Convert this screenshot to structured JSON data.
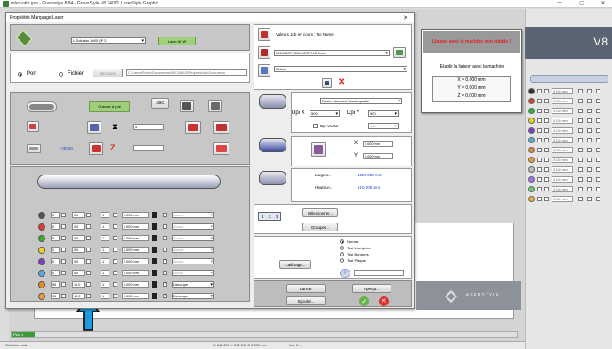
{
  "app": {
    "title": "robot-otto.gsh - Gravostyle 8.84 - GravoStyle V8 24001 LaserStyle Graphic",
    "window_controls": [
      "—",
      "▢",
      "✕"
    ],
    "v8_text": "V8",
    "status_left": "Sélection vide",
    "status_coords": "X 845.872  Y 810.392  Z 0.000 mm",
    "status_view": "Vue 2...",
    "doc_tab": "Plan 1"
  },
  "dialog": {
    "title": "Propriétés Marquage Laser",
    "machine_combo": "L-Solution 1000 (IP 2",
    "laser_btn": "Laser 80 W",
    "port_label": "Port",
    "file_label": "Fichier",
    "browse_btn": "Parcourir",
    "file_path": "C:\\Users\\Public\\Documents\\MECANIUS\\ProjetsWork\\Gravure.ini",
    "values_label": "Valeurs Job en cours : No Name",
    "material_combo": "L510000P-80W-ACRYLIC 5mm",
    "default_combo": "Défaut",
    "engrave_btn": "Gravure à plat",
    "abc_btn": "ABC",
    "x_value": "5",
    "offset_label": "+30,30",
    "raster_combo": "Raster standard Haute qualité",
    "dpi_x_label": "Dpi X",
    "dpi_x_value": "500",
    "dpi_y_label": "Dpi Y",
    "dpi_y_value": "500",
    "dpi_vector_label": "Dpi Vector",
    "dpi_vector_value": "500",
    "coord_x_label": "X",
    "coord_x_value": "0.000 mm",
    "coord_y_label": "Y",
    "coord_y_value": "0.000 mm",
    "width_label": "Largeur=",
    "width_value": "1220.000 mm",
    "height_label": "Hauteur=",
    "height_value": "610.000 mm",
    "pages": [
      "1",
      "2",
      "3"
    ],
    "select_btn": "Sélectionner...",
    "group_btn": "Grouper...",
    "calibrate_btn": "Calibrage...",
    "mode_options": [
      "Normal",
      "Test Inscription",
      "Test Bordures",
      "Test Plaque"
    ],
    "run_btn": "Lancer",
    "preview_btn": "Aperçu...",
    "spool_btn": "Spooler...",
    "logo_text": "LASERSTYLE",
    "pass_rows": [
      {
        "color": "#555555",
        "a": "0",
        "b": "0.0",
        "c": "1",
        "d": "0.000 mm",
        "mode": "Aucun",
        "checked": false
      },
      {
        "color": "#e23b2e",
        "a": "0",
        "b": "0.0",
        "c": "1",
        "d": "0.000 mm",
        "mode": "Aucun",
        "checked": false
      },
      {
        "color": "#2fb52f",
        "a": "0",
        "b": "0.0",
        "c": "1",
        "d": "0.000 mm",
        "mode": "Aucun",
        "checked": false
      },
      {
        "color": "#f1d21d",
        "a": "0",
        "b": "0.0",
        "c": "1",
        "d": "0.000 mm",
        "mode": "Aucun",
        "checked": false
      },
      {
        "color": "#7b3fc9",
        "a": "0",
        "b": "0.0",
        "c": "1",
        "d": "0.000 mm",
        "mode": "Aucun",
        "checked": true
      },
      {
        "color": "#4fb0e0",
        "a": "0",
        "b": "0.0",
        "c": "1",
        "d": "0.000 mm",
        "mode": "Aucun",
        "checked": false
      },
      {
        "color": "#e88a2a",
        "a": "95",
        "b": "10.0",
        "c": "1",
        "d": "0.000 mm",
        "mode": "Découpe",
        "checked": true
      },
      {
        "color": "#f0a032",
        "a": "95",
        "b": "10.0",
        "c": "1",
        "d": "0.000 mm",
        "mode": "Découpe",
        "checked": true
      }
    ]
  },
  "popup": {
    "header": "Liaison avec la machine non établie !",
    "action": "Etablir la liaison avec la machine",
    "x": "X = 0.000 mm",
    "y": "Y = 0.000 mm",
    "z": "Z = 0.000 mm"
  },
  "right_panel": {
    "field_value": "0.100 mm",
    "colors": [
      "#333333",
      "#e23b2e",
      "#2fb52f",
      "#f1d21d",
      "#7b3fc9",
      "#4fb0e0",
      "#e88a2a",
      "#f0a032",
      "#bfbfbf",
      "#a070ff",
      "#66cc66",
      "#ffaa33"
    ]
  },
  "colors": {
    "accent": "#3a7d3a",
    "blue_text": "#1a3fc0",
    "error_red": "#e02020"
  }
}
